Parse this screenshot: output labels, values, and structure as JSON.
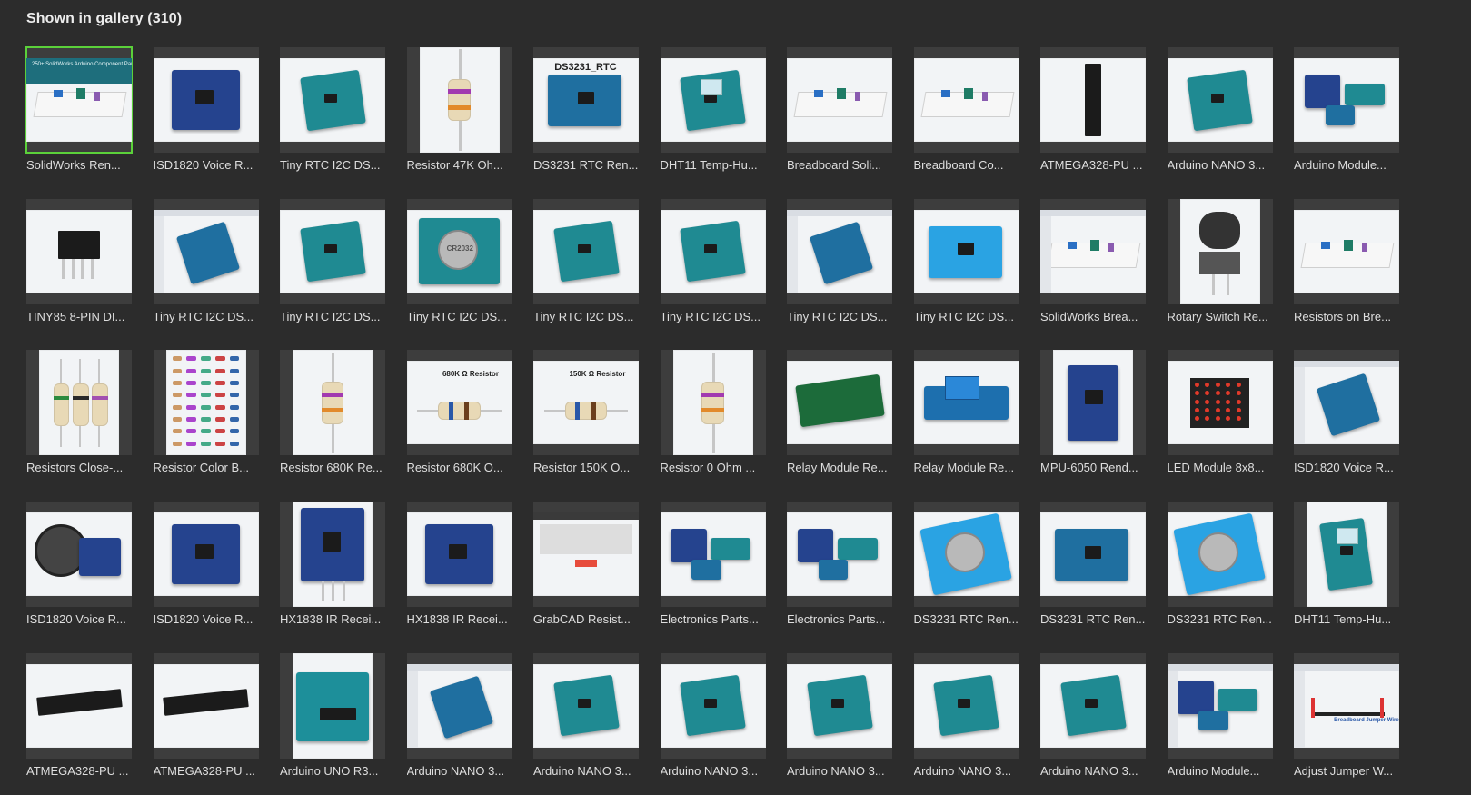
{
  "gallery": {
    "title": "Shown in gallery (310)"
  },
  "items": [
    {
      "caption": "SolidWorks Ren...",
      "kind": "breadboard",
      "fit": "w",
      "selected": true,
      "banner": "250+ SolidWorks Arduino Component Parts Files"
    },
    {
      "caption": "ISD1820 Voice R...",
      "kind": "pcb-navy-chip",
      "fit": "w"
    },
    {
      "caption": "Tiny RTC I2C DS...",
      "kind": "pcb-teal",
      "fit": "w"
    },
    {
      "caption": "Resistor 47K Oh...",
      "kind": "resistor-vertical",
      "fit": "t"
    },
    {
      "caption": "DS3231 RTC Ren...",
      "kind": "pcb-blue-label",
      "fit": "w",
      "label": "DS3231_RTC"
    },
    {
      "caption": "DHT11 Temp-Hu...",
      "kind": "pcb-teal-sensor",
      "fit": "w"
    },
    {
      "caption": "Breadboard Soli...",
      "kind": "breadboard",
      "fit": "w"
    },
    {
      "caption": "Breadboard Co...",
      "kind": "breadboard",
      "fit": "w"
    },
    {
      "caption": "ATMEGA328-PU ...",
      "kind": "chip-vertical",
      "fit": "w"
    },
    {
      "caption": "Arduino NANO 3...",
      "kind": "pcb-teal-board",
      "fit": "w"
    },
    {
      "caption": "Arduino Module...",
      "kind": "modules",
      "fit": "w"
    },
    {
      "caption": "TINY85 8-PIN DI...",
      "kind": "chip-8pin",
      "fit": "w"
    },
    {
      "caption": "Tiny RTC I2C DS...",
      "kind": "screenshot-pcb",
      "fit": "w"
    },
    {
      "caption": "Tiny RTC I2C DS...",
      "kind": "pcb-teal",
      "fit": "w"
    },
    {
      "caption": "Tiny RTC I2C DS...",
      "kind": "pcb-battery",
      "fit": "w",
      "label": "CR2032"
    },
    {
      "caption": "Tiny RTC I2C DS...",
      "kind": "pcb-teal",
      "fit": "w"
    },
    {
      "caption": "Tiny RTC I2C DS...",
      "kind": "pcb-teal",
      "fit": "w"
    },
    {
      "caption": "Tiny RTC I2C DS...",
      "kind": "screenshot-pcb",
      "fit": "w"
    },
    {
      "caption": "Tiny RTC I2C DS...",
      "kind": "pcb-blue-light",
      "fit": "w"
    },
    {
      "caption": "SolidWorks Brea...",
      "kind": "screenshot-breadboard",
      "fit": "w"
    },
    {
      "caption": "Rotary Switch Re...",
      "kind": "knob",
      "fit": "t"
    },
    {
      "caption": "Resistors on Bre...",
      "kind": "breadboard-close",
      "fit": "w"
    },
    {
      "caption": "Resistors Close-...",
      "kind": "resistors-three",
      "fit": "t"
    },
    {
      "caption": "Resistor Color B...",
      "kind": "resistor-grid",
      "fit": "t"
    },
    {
      "caption": "Resistor 680K Re...",
      "kind": "resistor-vertical",
      "fit": "t"
    },
    {
      "caption": "Resistor 680K O...",
      "kind": "resistor-horizontal",
      "fit": "w",
      "label": "680K Ω Resistor"
    },
    {
      "caption": "Resistor 150K O...",
      "kind": "resistor-horizontal",
      "fit": "w",
      "label": "150K Ω Resistor"
    },
    {
      "caption": "Resistor 0 Ohm ...",
      "kind": "resistor-vertical",
      "fit": "t"
    },
    {
      "caption": "Relay Module Re...",
      "kind": "pcb-green",
      "fit": "w"
    },
    {
      "caption": "Relay Module Re...",
      "kind": "relay",
      "fit": "w"
    },
    {
      "caption": "MPU-6050 Rend...",
      "kind": "pcb-navy-chip",
      "fit": "t"
    },
    {
      "caption": "LED Module 8x8...",
      "kind": "led-matrix",
      "fit": "w"
    },
    {
      "caption": "ISD1820 Voice R...",
      "kind": "screenshot-pcb",
      "fit": "w"
    },
    {
      "caption": "ISD1820 Voice R...",
      "kind": "speaker",
      "fit": "w"
    },
    {
      "caption": "ISD1820 Voice R...",
      "kind": "pcb-navy-chip",
      "fit": "w"
    },
    {
      "caption": "HX1838 IR Recei...",
      "kind": "ir-receiver",
      "fit": "t"
    },
    {
      "caption": "HX1838 IR Recei...",
      "kind": "pcb-navy-chip",
      "fit": "w"
    },
    {
      "caption": "GrabCAD Resist...",
      "kind": "webpage",
      "fit": "w"
    },
    {
      "caption": "Electronics Parts...",
      "kind": "modules",
      "fit": "w"
    },
    {
      "caption": "Electronics Parts...",
      "kind": "modules",
      "fit": "w"
    },
    {
      "caption": "DS3231 RTC Ren...",
      "kind": "pcb-battery-blue",
      "fit": "w"
    },
    {
      "caption": "DS3231 RTC Ren...",
      "kind": "pcb-blue",
      "fit": "w"
    },
    {
      "caption": "DS3231 RTC Ren...",
      "kind": "pcb-battery-blue",
      "fit": "w"
    },
    {
      "caption": "DHT11 Temp-Hu...",
      "kind": "pcb-teal-sensor-v",
      "fit": "t"
    },
    {
      "caption": "ATMEGA328-PU ...",
      "kind": "chip-dip",
      "fit": "w"
    },
    {
      "caption": "ATMEGA328-PU ...",
      "kind": "chip-dip",
      "fit": "w"
    },
    {
      "caption": "Arduino UNO R3...",
      "kind": "uno",
      "fit": "t"
    },
    {
      "caption": "Arduino NANO 3...",
      "kind": "screenshot-pcb",
      "fit": "w"
    },
    {
      "caption": "Arduino NANO 3...",
      "kind": "pcb-teal-board",
      "fit": "w"
    },
    {
      "caption": "Arduino NANO 3...",
      "kind": "pcb-teal",
      "fit": "w"
    },
    {
      "caption": "Arduino NANO 3...",
      "kind": "pcb-teal-board",
      "fit": "w"
    },
    {
      "caption": "Arduino NANO 3...",
      "kind": "pcb-teal-board",
      "fit": "w"
    },
    {
      "caption": "Arduino NANO 3...",
      "kind": "pcb-teal-board",
      "fit": "w"
    },
    {
      "caption": "Arduino Module...",
      "kind": "screenshot-modules",
      "fit": "w"
    },
    {
      "caption": "Adjust Jumper W...",
      "kind": "screenshot-wire",
      "fit": "w",
      "label": "Breadboard Jumper Wire"
    }
  ],
  "colors": {
    "background": "#2c2c2c",
    "selected_outline": "#5bd13a",
    "caption": "#dedede"
  }
}
